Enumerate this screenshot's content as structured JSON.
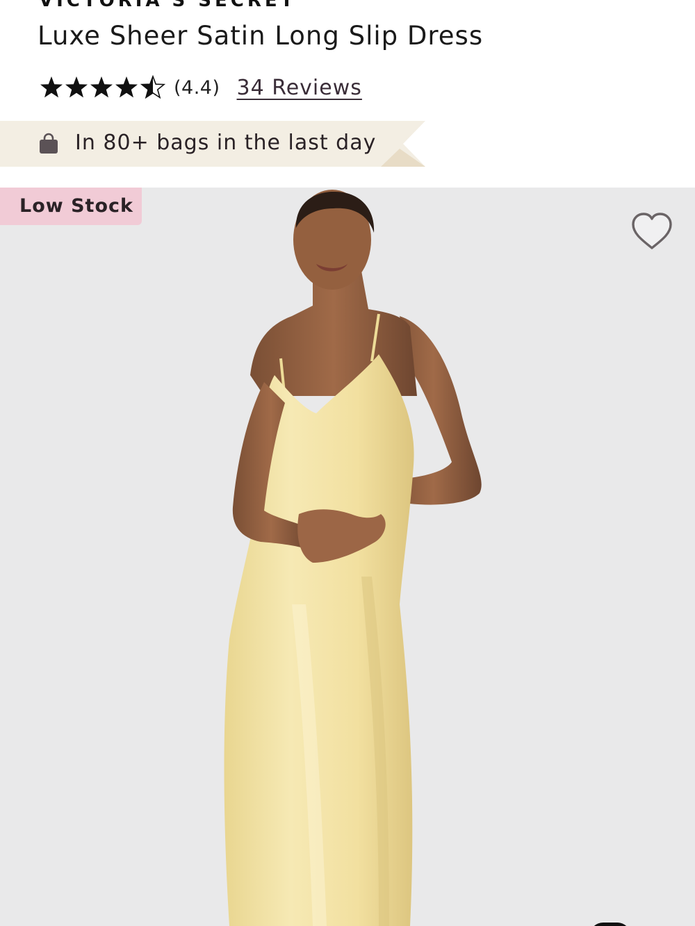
{
  "product": {
    "brand": "VICTORIA'S SECRET",
    "title": "Luxe Sheer Satin Long Slip Dress",
    "rating_display": "(4.4)",
    "rating_value": 4.4,
    "rating_max": 5,
    "reviews_link": "34 Reviews"
  },
  "social_proof": {
    "text": "In 80+ bags in the last day",
    "icon": "shopping-bag-icon"
  },
  "gallery": {
    "badge": "Low Stock",
    "wishlist_icon": "heart-outline-icon"
  },
  "colors": {
    "banner": "#f3eee3",
    "badge": "#f1cbd6",
    "image_bg": "#e9e9ea",
    "dress": "#f2e4a8",
    "link": "#3a2d38"
  }
}
